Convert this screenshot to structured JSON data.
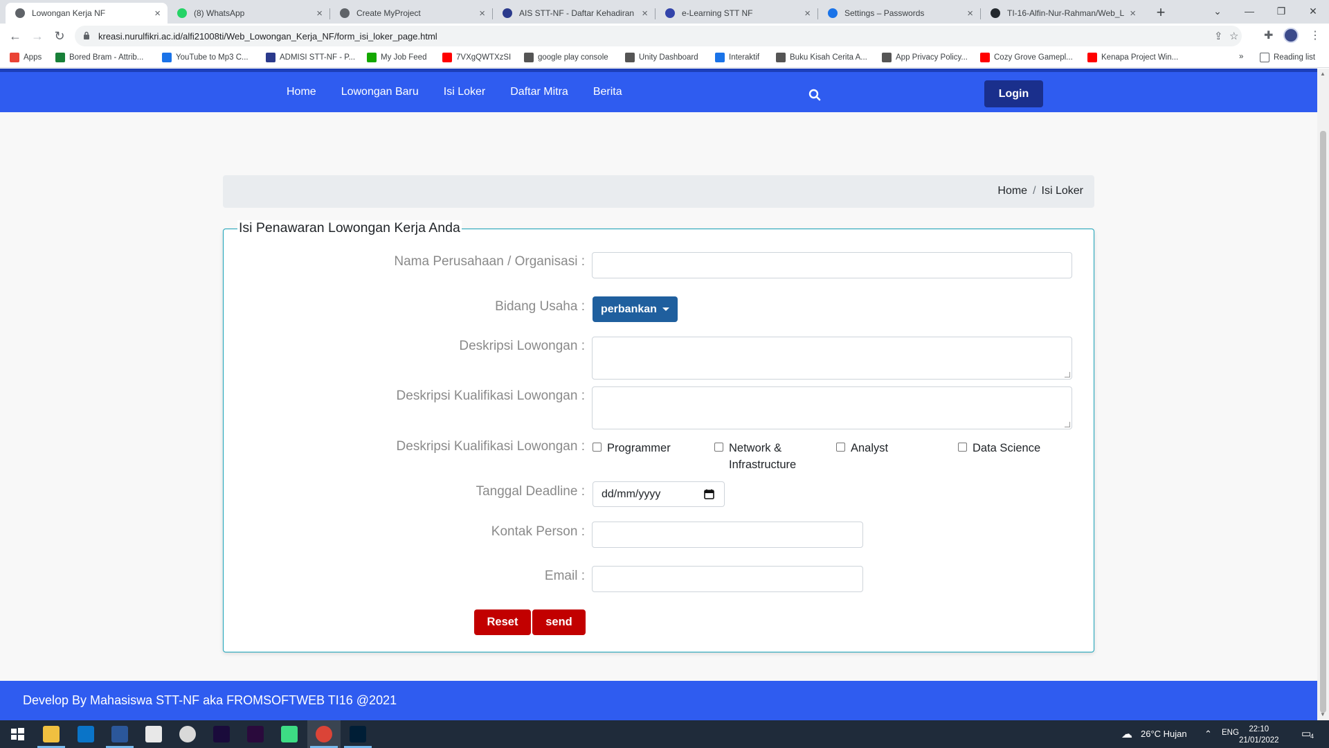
{
  "browser": {
    "tabs": [
      {
        "title": "Lowongan Kerja NF",
        "active": true,
        "favicon_color": "#5f6368"
      },
      {
        "title": "(8) WhatsApp",
        "active": false,
        "favicon_color": "#25d366"
      },
      {
        "title": "Create MyProject",
        "active": false,
        "favicon_color": "#5f6368"
      },
      {
        "title": "AIS STT-NF - Daftar Kehadiran",
        "active": false,
        "favicon_color": "#2b3a8c"
      },
      {
        "title": "e-Learning STT NF",
        "active": false,
        "favicon_color": "#3344aa"
      },
      {
        "title": "Settings – Passwords",
        "active": false,
        "favicon_color": "#1a73e8"
      },
      {
        "title": "TI-16-Alfin-Nur-Rahman/Web_L",
        "active": false,
        "favicon_color": "#24292e"
      }
    ],
    "url": "kreasi.nurulfikri.ac.id/alfi21008ti/Web_Lowongan_Kerja_NF/form_isi_loker_page.html",
    "bookmarks": [
      {
        "label": "Apps",
        "color": "#ea4335"
      },
      {
        "label": "Bored Bram - Attrib...",
        "color": "#188038"
      },
      {
        "label": "YouTube to Mp3 C...",
        "color": "#1a73e8"
      },
      {
        "label": "ADMISI STT-NF - P...",
        "color": "#2b3a8c"
      },
      {
        "label": "My Job Feed",
        "color": "#14a800"
      },
      {
        "label": "7VXgQWTXzSI",
        "color": "#ff0000"
      },
      {
        "label": "google play console",
        "color": "#555555"
      },
      {
        "label": "Unity Dashboard",
        "color": "#555555"
      },
      {
        "label": "Interaktif",
        "color": "#1a73e8"
      },
      {
        "label": "Buku Kisah Cerita A...",
        "color": "#555555"
      },
      {
        "label": "App Privacy Policy...",
        "color": "#555555"
      },
      {
        "label": "Cozy Grove Gamepl...",
        "color": "#ff0000"
      },
      {
        "label": "Kenapa Project Win...",
        "color": "#ff0000"
      }
    ],
    "bookmarks_more": "»",
    "reading_list": "Reading list"
  },
  "site": {
    "nav": [
      "Home",
      "Lowongan Baru",
      "Isi Loker",
      "Daftar Mitra",
      "Berita"
    ],
    "login": "Login",
    "colors": {
      "primary": "#2f5cf0",
      "login_bg": "#1a2f8c",
      "danger": "#c20000",
      "dropdown": "#1f5f9e"
    }
  },
  "breadcrumb": {
    "home": "Home",
    "separator": "/",
    "current": "Isi Loker"
  },
  "form": {
    "legend": "Isi Penawaran Lowongan Kerja Anda",
    "company_label": "Nama Perusahaan / Organisasi :",
    "company_value": "",
    "business_label": "Bidang Usaha :",
    "business_selected": "perbankan",
    "description_label": "Deskripsi Lowongan :",
    "qualification_label": "Deskripsi Kualifikasi Lowongan :",
    "category_label": "Deskripsi Kualifikasi Lowongan :",
    "categories": [
      {
        "label": "Programmer",
        "checked": false
      },
      {
        "label": "Network &",
        "label2": "Infrastructure",
        "checked": false
      },
      {
        "label": "Analyst",
        "checked": false
      },
      {
        "label": "Data Science",
        "checked": false
      }
    ],
    "deadline_label": "Tanggal Deadline :",
    "deadline_placeholder": "dd/mm/yyyy",
    "contact_label": "Kontak Person :",
    "email_label": "Email :",
    "reset": "Reset",
    "send": "send"
  },
  "footer": {
    "text": "Develop By Mahasiswa STT-NF aka FROMSOFTWEB TI16 @2021"
  },
  "taskbar": {
    "weather": "26°C  Hujan",
    "lang": "ENG",
    "time": "22:10",
    "date": "21/01/2022",
    "notifications": "4"
  }
}
